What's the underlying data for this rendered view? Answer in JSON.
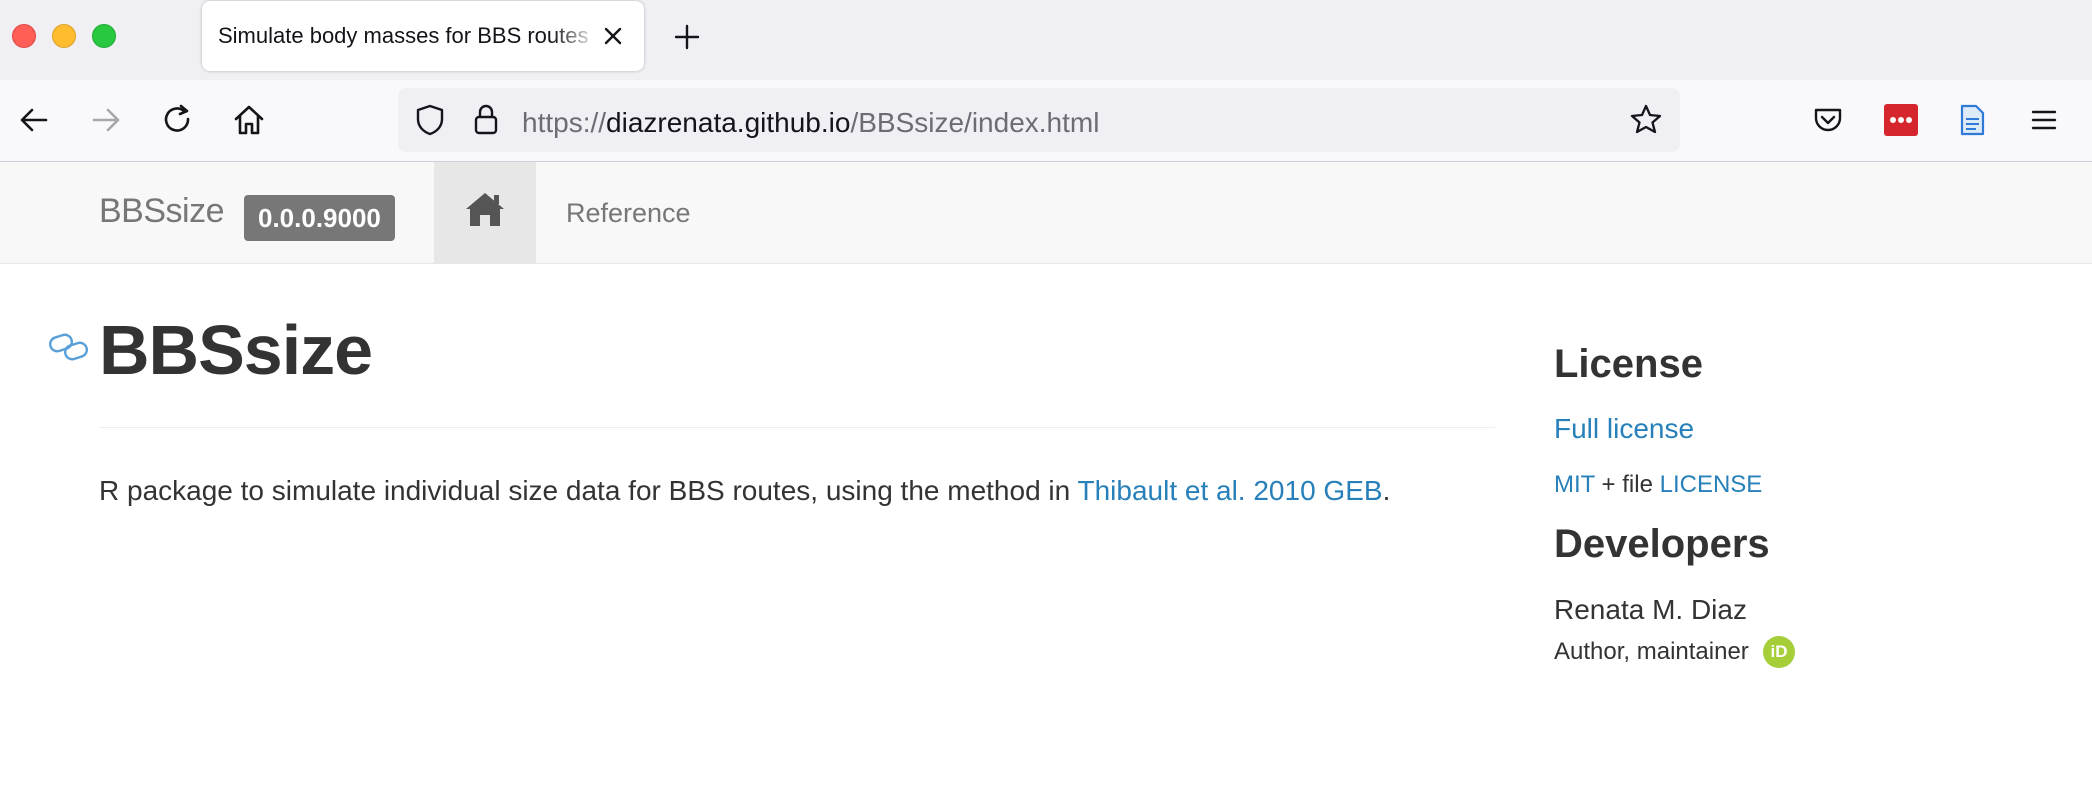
{
  "browser": {
    "tab_title": "Simulate body masses for BBS routes",
    "url_scheme": "https://",
    "url_host": "diazrenata.github.io",
    "url_path": "/BBSsize/index.html",
    "icons": [
      "back-icon",
      "forward-icon",
      "reload-icon",
      "home-icon",
      "shield-icon",
      "lock-icon",
      "bookmark-star-icon",
      "pocket-icon",
      "extension-icon",
      "reader-icon",
      "menu-icon",
      "close-icon",
      "plus-icon"
    ]
  },
  "site": {
    "brand": "BBSsize",
    "version": "0.0.0.9000",
    "nav_reference": "Reference",
    "title": "BBSsize",
    "description_prefix": "R package to simulate individual size data for BBS routes, using the method in ",
    "description_link": "Thibault et al. 2010 GEB",
    "description_suffix": ".",
    "link_color": "#2780b9"
  },
  "sidebar": {
    "license_heading": "License",
    "full_license": "Full license",
    "license_mit": "MIT",
    "license_plus_file": " + file ",
    "license_file": "LICENSE",
    "developers_heading": "Developers",
    "developer_name": "Renata M. Diaz",
    "developer_role": "Author, maintainer",
    "orcid_label": "iD"
  }
}
